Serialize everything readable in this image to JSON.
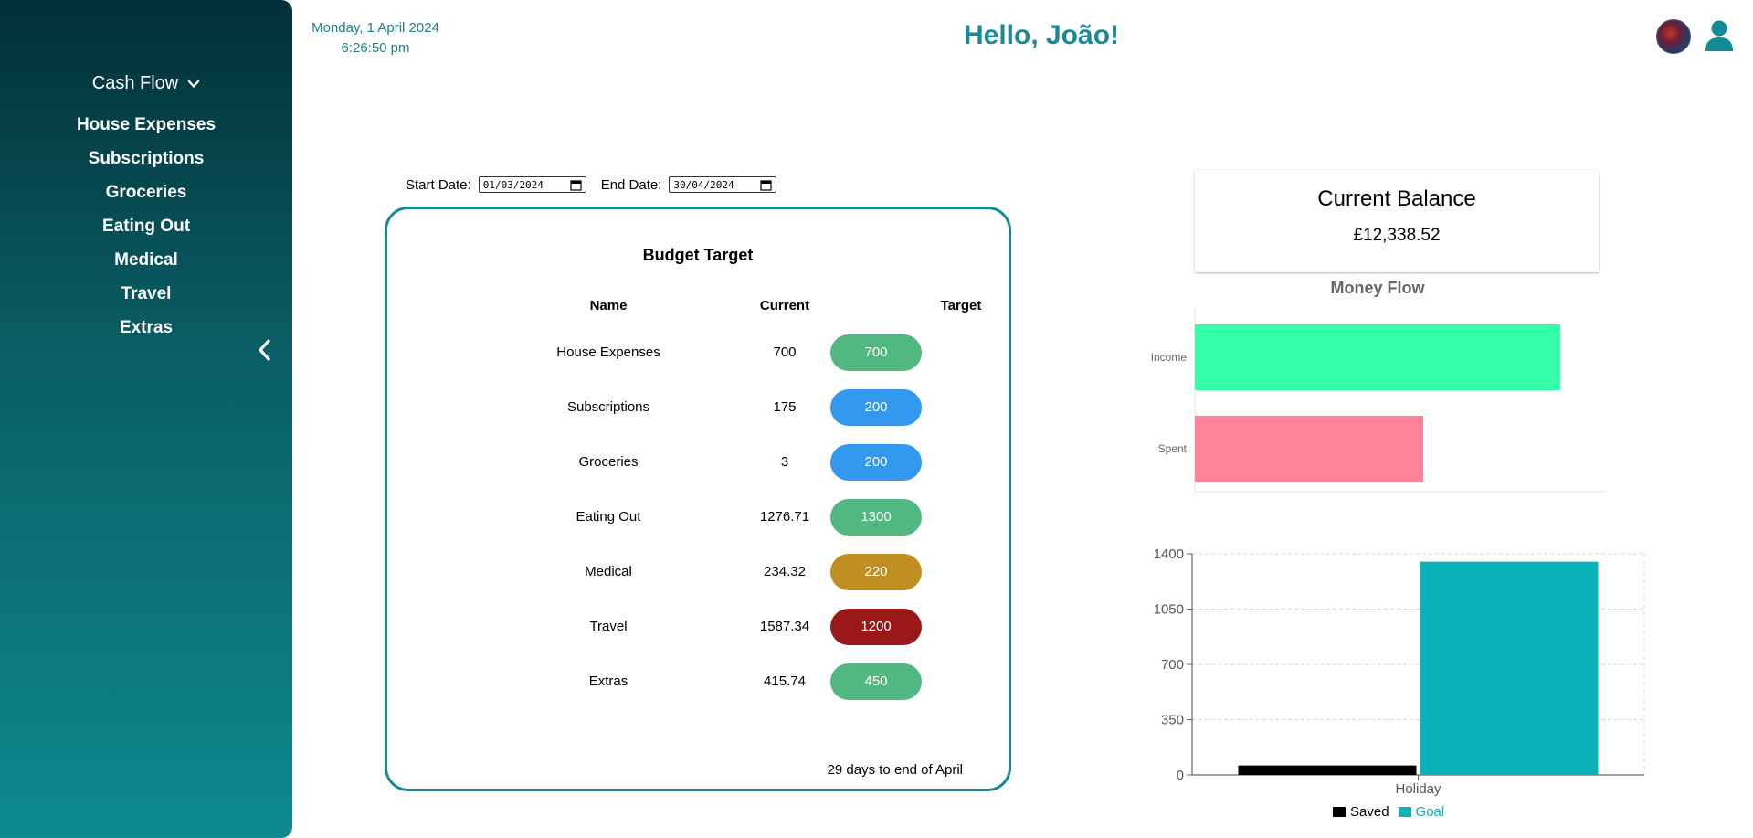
{
  "sidebar": {
    "section_label": "Cash Flow",
    "items": [
      {
        "label": "House Expenses"
      },
      {
        "label": "Subscriptions"
      },
      {
        "label": "Groceries"
      },
      {
        "label": "Eating Out"
      },
      {
        "label": "Medical"
      },
      {
        "label": "Travel"
      },
      {
        "label": "Extras"
      }
    ]
  },
  "header": {
    "date": "Monday, 1 April 2024",
    "time": "6:26:50 pm",
    "greeting": "Hello, João!"
  },
  "filters": {
    "start_label": "Start Date:",
    "start_value": "01/03/2024",
    "end_label": "End Date:",
    "end_value": "30/04/2024"
  },
  "budget": {
    "title": "Budget Target",
    "headers": {
      "name": "Name",
      "current": "Current",
      "target": "Target"
    },
    "rows": [
      {
        "name": "House Expenses",
        "current": "700",
        "target": "700",
        "color": "#52b882"
      },
      {
        "name": "Subscriptions",
        "current": "175",
        "target": "200",
        "color": "#3399ee"
      },
      {
        "name": "Groceries",
        "current": "3",
        "target": "200",
        "color": "#3399ee"
      },
      {
        "name": "Eating Out",
        "current": "1276.71",
        "target": "1300",
        "color": "#52b882"
      },
      {
        "name": "Medical",
        "current": "234.32",
        "target": "220",
        "color": "#c18f21"
      },
      {
        "name": "Travel",
        "current": "1587.34",
        "target": "1200",
        "color": "#9a1818"
      },
      {
        "name": "Extras",
        "current": "415.74",
        "target": "450",
        "color": "#52b882"
      }
    ],
    "footer": "29 days to end of April"
  },
  "balance": {
    "title": "Current Balance",
    "value": "£12,338.52"
  },
  "chart_data": [
    {
      "type": "bar",
      "orientation": "horizontal",
      "title": "Money Flow",
      "categories": [
        "Income",
        "Spent"
      ],
      "values": [
        4000,
        2500
      ],
      "colors": [
        "#33ffa8",
        "#ff8299"
      ],
      "xlim": [
        0,
        4500
      ],
      "grid": false
    },
    {
      "type": "bar",
      "categories": [
        "Holiday"
      ],
      "series": [
        {
          "name": "Saved",
          "values": [
            60
          ],
          "color": "#000000"
        },
        {
          "name": "Goal",
          "values": [
            1350
          ],
          "color": "#0ab3b8"
        }
      ],
      "ylim": [
        0,
        1400
      ],
      "yticks": [
        "0",
        "350",
        "700",
        "1050",
        "1400"
      ],
      "grid": true,
      "legend": "bottom"
    }
  ]
}
